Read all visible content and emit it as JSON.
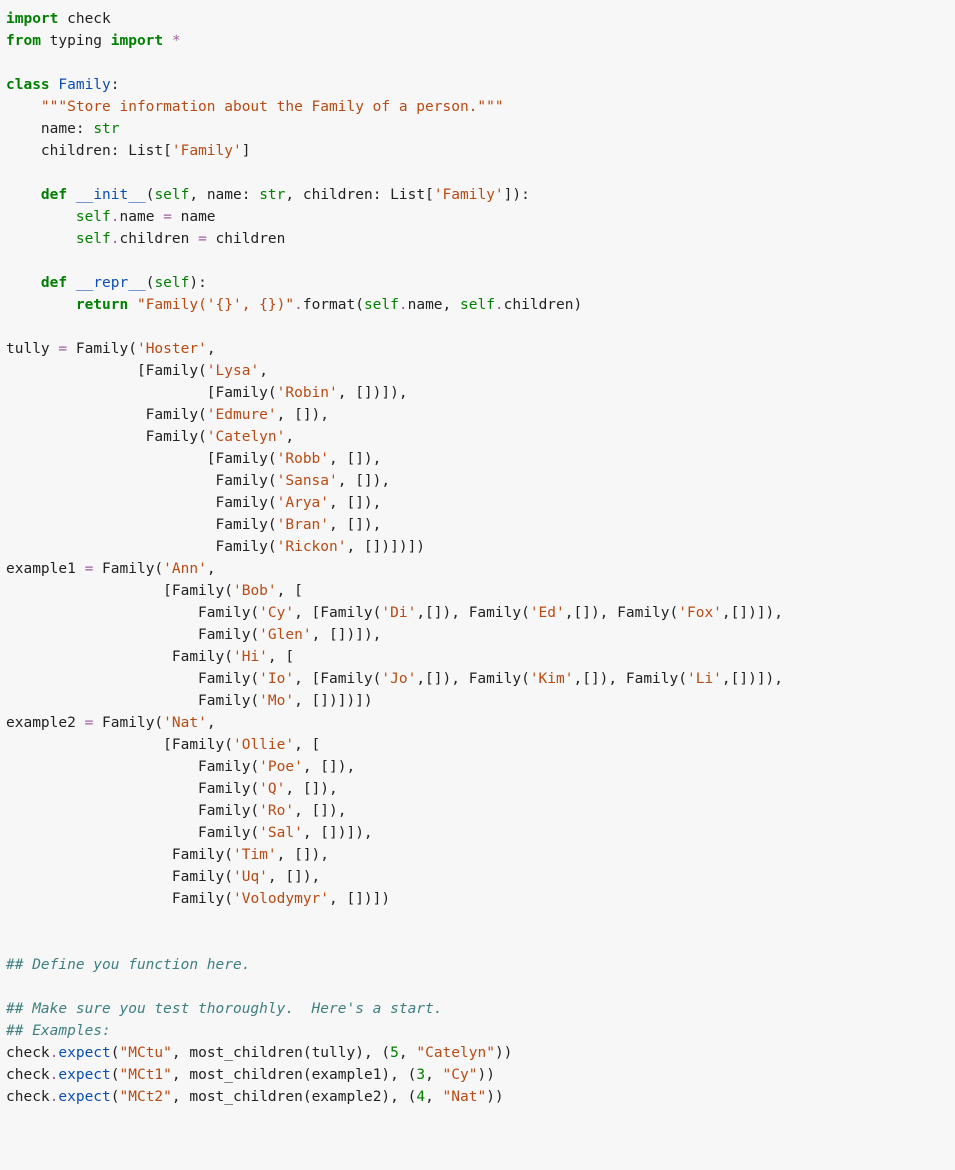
{
  "code": {
    "lines": [
      [
        [
          "kw",
          "import"
        ],
        [
          "nm",
          " check"
        ]
      ],
      [
        [
          "kw",
          "from"
        ],
        [
          "nm",
          " typing "
        ],
        [
          "kw",
          "import"
        ],
        [
          "nm",
          " "
        ],
        [
          "op",
          "*"
        ]
      ],
      [
        [
          "nm",
          ""
        ]
      ],
      [
        [
          "kw",
          "class"
        ],
        [
          "nm",
          " "
        ],
        [
          "cls",
          "Family"
        ],
        [
          "nm",
          ":"
        ]
      ],
      [
        [
          "nm",
          "    "
        ],
        [
          "str",
          "\"\"\"Store information about the Family of a person.\"\"\""
        ]
      ],
      [
        [
          "nm",
          "    name: "
        ],
        [
          "bt",
          "str"
        ]
      ],
      [
        [
          "nm",
          "    children: List["
        ],
        [
          "str",
          "'Family'"
        ],
        [
          "nm",
          "]"
        ]
      ],
      [
        [
          "nm",
          ""
        ]
      ],
      [
        [
          "nm",
          "    "
        ],
        [
          "kw",
          "def"
        ],
        [
          "nm",
          " "
        ],
        [
          "fn",
          "__init__"
        ],
        [
          "nm",
          "("
        ],
        [
          "self",
          "self"
        ],
        [
          "nm",
          ", name: "
        ],
        [
          "bt",
          "str"
        ],
        [
          "nm",
          ", children: List["
        ],
        [
          "str",
          "'Family'"
        ],
        [
          "nm",
          "]):"
        ]
      ],
      [
        [
          "nm",
          "        "
        ],
        [
          "self",
          "self"
        ],
        [
          "op",
          "."
        ],
        [
          "nm",
          "name "
        ],
        [
          "op",
          "="
        ],
        [
          "nm",
          " name"
        ]
      ],
      [
        [
          "nm",
          "        "
        ],
        [
          "self",
          "self"
        ],
        [
          "op",
          "."
        ],
        [
          "nm",
          "children "
        ],
        [
          "op",
          "="
        ],
        [
          "nm",
          " children"
        ]
      ],
      [
        [
          "nm",
          ""
        ]
      ],
      [
        [
          "nm",
          "    "
        ],
        [
          "kw",
          "def"
        ],
        [
          "nm",
          " "
        ],
        [
          "fn",
          "__repr__"
        ],
        [
          "nm",
          "("
        ],
        [
          "self",
          "self"
        ],
        [
          "nm",
          "):"
        ]
      ],
      [
        [
          "nm",
          "        "
        ],
        [
          "kw",
          "return"
        ],
        [
          "nm",
          " "
        ],
        [
          "str",
          "\"Family('{}', {})\""
        ],
        [
          "op",
          "."
        ],
        [
          "nm",
          "format("
        ],
        [
          "self",
          "self"
        ],
        [
          "op",
          "."
        ],
        [
          "nm",
          "name, "
        ],
        [
          "self",
          "self"
        ],
        [
          "op",
          "."
        ],
        [
          "nm",
          "children)"
        ]
      ],
      [
        [
          "nm",
          ""
        ]
      ],
      [
        [
          "nm",
          "tully "
        ],
        [
          "op",
          "="
        ],
        [
          "nm",
          " Family("
        ],
        [
          "str",
          "'Hoster'"
        ],
        [
          "nm",
          ","
        ]
      ],
      [
        [
          "nm",
          "               [Family("
        ],
        [
          "str",
          "'Lysa'"
        ],
        [
          "nm",
          ","
        ]
      ],
      [
        [
          "nm",
          "                       [Family("
        ],
        [
          "str",
          "'Robin'"
        ],
        [
          "nm",
          ", [])]),"
        ]
      ],
      [
        [
          "nm",
          "                Family("
        ],
        [
          "str",
          "'Edmure'"
        ],
        [
          "nm",
          ", []),"
        ]
      ],
      [
        [
          "nm",
          "                Family("
        ],
        [
          "str",
          "'Catelyn'"
        ],
        [
          "nm",
          ","
        ]
      ],
      [
        [
          "nm",
          "                       [Family("
        ],
        [
          "str",
          "'Robb'"
        ],
        [
          "nm",
          ", []),"
        ]
      ],
      [
        [
          "nm",
          "                        Family("
        ],
        [
          "str",
          "'Sansa'"
        ],
        [
          "nm",
          ", []),"
        ]
      ],
      [
        [
          "nm",
          "                        Family("
        ],
        [
          "str",
          "'Arya'"
        ],
        [
          "nm",
          ", []),"
        ]
      ],
      [
        [
          "nm",
          "                        Family("
        ],
        [
          "str",
          "'Bran'"
        ],
        [
          "nm",
          ", []),"
        ]
      ],
      [
        [
          "nm",
          "                        Family("
        ],
        [
          "str",
          "'Rickon'"
        ],
        [
          "nm",
          ", [])])])"
        ]
      ],
      [
        [
          "nm",
          "example1 "
        ],
        [
          "op",
          "="
        ],
        [
          "nm",
          " Family("
        ],
        [
          "str",
          "'Ann'"
        ],
        [
          "nm",
          ","
        ]
      ],
      [
        [
          "nm",
          "                  [Family("
        ],
        [
          "str",
          "'Bob'"
        ],
        [
          "nm",
          ", ["
        ]
      ],
      [
        [
          "nm",
          "                      Family("
        ],
        [
          "str",
          "'Cy'"
        ],
        [
          "nm",
          ", [Family("
        ],
        [
          "str",
          "'Di'"
        ],
        [
          "nm",
          ",[]), Family("
        ],
        [
          "str",
          "'Ed'"
        ],
        [
          "nm",
          ",[]), Family("
        ],
        [
          "str",
          "'Fox'"
        ],
        [
          "nm",
          ",[])]),"
        ]
      ],
      [
        [
          "nm",
          "                      Family("
        ],
        [
          "str",
          "'Glen'"
        ],
        [
          "nm",
          ", [])]),"
        ]
      ],
      [
        [
          "nm",
          "                   Family("
        ],
        [
          "str",
          "'Hi'"
        ],
        [
          "nm",
          ", ["
        ]
      ],
      [
        [
          "nm",
          "                      Family("
        ],
        [
          "str",
          "'Io'"
        ],
        [
          "nm",
          ", [Family("
        ],
        [
          "str",
          "'Jo'"
        ],
        [
          "nm",
          ",[]), Family("
        ],
        [
          "str",
          "'Kim'"
        ],
        [
          "nm",
          ",[]), Family("
        ],
        [
          "str",
          "'Li'"
        ],
        [
          "nm",
          ",[])]),"
        ]
      ],
      [
        [
          "nm",
          "                      Family("
        ],
        [
          "str",
          "'Mo'"
        ],
        [
          "nm",
          ", [])])])"
        ]
      ],
      [
        [
          "nm",
          "example2 "
        ],
        [
          "op",
          "="
        ],
        [
          "nm",
          " Family("
        ],
        [
          "str",
          "'Nat'"
        ],
        [
          "nm",
          ","
        ]
      ],
      [
        [
          "nm",
          "                  [Family("
        ],
        [
          "str",
          "'Ollie'"
        ],
        [
          "nm",
          ", ["
        ]
      ],
      [
        [
          "nm",
          "                      Family("
        ],
        [
          "str",
          "'Poe'"
        ],
        [
          "nm",
          ", []),"
        ]
      ],
      [
        [
          "nm",
          "                      Family("
        ],
        [
          "str",
          "'Q'"
        ],
        [
          "nm",
          ", []),"
        ]
      ],
      [
        [
          "nm",
          "                      Family("
        ],
        [
          "str",
          "'Ro'"
        ],
        [
          "nm",
          ", []),"
        ]
      ],
      [
        [
          "nm",
          "                      Family("
        ],
        [
          "str",
          "'Sal'"
        ],
        [
          "nm",
          ", [])]),"
        ]
      ],
      [
        [
          "nm",
          "                   Family("
        ],
        [
          "str",
          "'Tim'"
        ],
        [
          "nm",
          ", []),"
        ]
      ],
      [
        [
          "nm",
          "                   Family("
        ],
        [
          "str",
          "'Uq'"
        ],
        [
          "nm",
          ", []),"
        ]
      ],
      [
        [
          "nm",
          "                   Family("
        ],
        [
          "str",
          "'Volodymyr'"
        ],
        [
          "nm",
          ", [])])"
        ]
      ],
      [
        [
          "nm",
          ""
        ]
      ],
      [
        [
          "nm",
          ""
        ]
      ],
      [
        [
          "cmt",
          "## Define you function here."
        ]
      ],
      [
        [
          "nm",
          ""
        ]
      ],
      [
        [
          "cmt",
          "## Make sure you test thoroughly.  Here's a start."
        ]
      ],
      [
        [
          "cmt",
          "## Examples:"
        ]
      ],
      [
        [
          "nm",
          "check"
        ],
        [
          "op",
          "."
        ],
        [
          "attr",
          "expect"
        ],
        [
          "nm",
          "("
        ],
        [
          "str",
          "\"MCtu\""
        ],
        [
          "nm",
          ", most_children(tully), ("
        ],
        [
          "num",
          "5"
        ],
        [
          "nm",
          ", "
        ],
        [
          "str",
          "\"Catelyn\""
        ],
        [
          "nm",
          "))"
        ]
      ],
      [
        [
          "nm",
          "check"
        ],
        [
          "op",
          "."
        ],
        [
          "attr",
          "expect"
        ],
        [
          "nm",
          "("
        ],
        [
          "str",
          "\"MCt1\""
        ],
        [
          "nm",
          ", most_children(example1), ("
        ],
        [
          "num",
          "3"
        ],
        [
          "nm",
          ", "
        ],
        [
          "str",
          "\"Cy\""
        ],
        [
          "nm",
          "))"
        ]
      ],
      [
        [
          "nm",
          "check"
        ],
        [
          "op",
          "."
        ],
        [
          "attr",
          "expect"
        ],
        [
          "nm",
          "("
        ],
        [
          "str",
          "\"MCt2\""
        ],
        [
          "nm",
          ", most_children(example2), ("
        ],
        [
          "num",
          "4"
        ],
        [
          "nm",
          ", "
        ],
        [
          "str",
          "\"Nat\""
        ],
        [
          "nm",
          "))"
        ]
      ]
    ]
  }
}
